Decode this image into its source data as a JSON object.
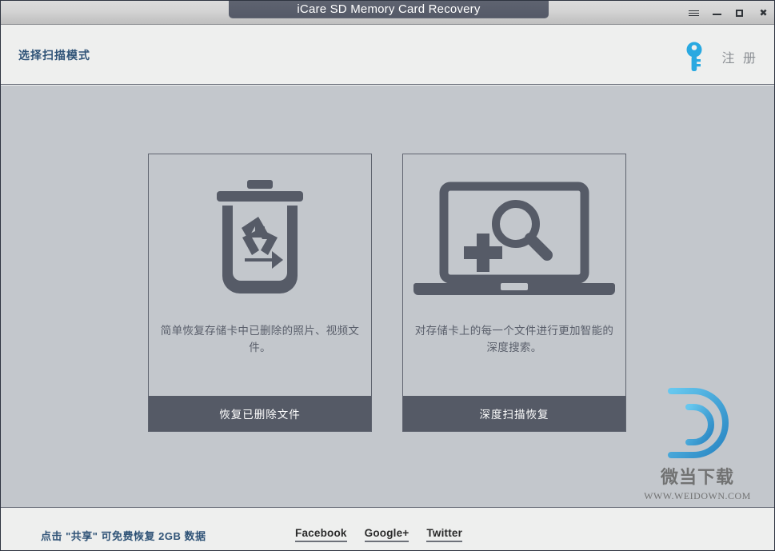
{
  "window": {
    "title": "iCare SD Memory Card Recovery",
    "controls": [
      {
        "name": "menu",
        "glyph": "☰"
      },
      {
        "name": "minimize",
        "glyph": "–"
      },
      {
        "name": "maximize",
        "glyph": "□"
      },
      {
        "name": "close",
        "glyph": "✖"
      }
    ]
  },
  "header": {
    "title": "选择扫描模式",
    "register_label": "注 册",
    "key_icon_color": "#29a9e1"
  },
  "main": {
    "background_color": "#c3c7cc",
    "cards": [
      {
        "icon": "recycle-bin-icon",
        "description": "简单恢复存储卡中已删除的照片、视频文件。",
        "action_label": "恢复已删除文件",
        "action_color": "#555a66"
      },
      {
        "icon": "deep-scan-laptop-icon",
        "description": "对存储卡上的每一个文件进行更加智能的深度搜索。",
        "action_label": "深度扫描恢复",
        "action_color": "#555a66"
      }
    ]
  },
  "watermark": {
    "logo_letter": "D",
    "name": "微当下载",
    "url": "WWW.WEIDOWN.COM",
    "logo_color": "#29a9e1"
  },
  "footer": {
    "note": "点击 \"共享\" 可免费恢复 2GB 数据",
    "social": [
      {
        "label": "Facebook"
      },
      {
        "label": "Google+"
      },
      {
        "label": "Twitter"
      }
    ]
  }
}
